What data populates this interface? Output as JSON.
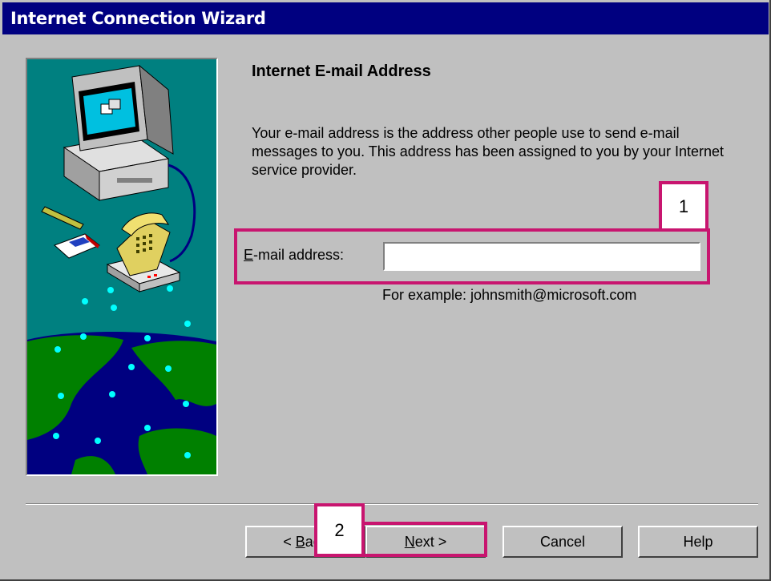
{
  "window": {
    "title": "Internet Connection Wizard"
  },
  "page": {
    "heading": "Internet E-mail Address",
    "description": "Your e-mail address is the address other people use to send e-mail messages to you. This address has been assigned to you by your Internet service provider."
  },
  "form": {
    "email_label_accel": "E",
    "email_label_rest": "-mail address:",
    "email_value": "",
    "example": "For example: johnsmith@microsoft.com"
  },
  "buttons": {
    "back_prefix": "< ",
    "back_accel": "B",
    "back_rest": "ack",
    "next_accel": "N",
    "next_rest": "ext >",
    "cancel": "Cancel",
    "help": "Help"
  },
  "annotations": {
    "marker_1": "1",
    "marker_2": "2",
    "highlight_color": "#c8156f"
  },
  "illustration": {
    "icons": [
      "computer-icon",
      "telephone-icon",
      "globe-icon",
      "pencil-icon",
      "envelope-icon"
    ],
    "colors": {
      "sky": "#008080",
      "ocean": "#000080",
      "land": "#008000",
      "dots": "#00ffff"
    }
  }
}
